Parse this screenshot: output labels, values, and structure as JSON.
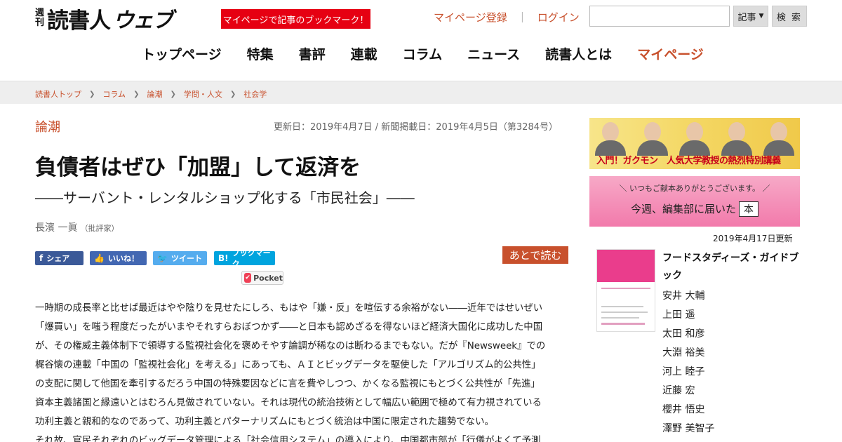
{
  "header": {
    "logo_sub": [
      "週",
      "刊"
    ],
    "logo_main": "読書人",
    "logo_web": "ウェブ",
    "bookmark_banner": "マイページで記事のブックマーク！",
    "register_link": "マイページ登録",
    "separator": "｜",
    "login_link": "ログイン",
    "search_placeholder": "",
    "search_scope": "記事",
    "search_button": "検 索"
  },
  "nav": {
    "items": [
      "トップページ",
      "特集",
      "書評",
      "連載",
      "コラム",
      "ニュース",
      "読書人とは",
      "マイページ"
    ]
  },
  "breadcrumb": [
    "読書人トップ",
    "コラム",
    "論潮",
    "学問・人文",
    "社会学"
  ],
  "article": {
    "category": "論潮",
    "dates": "更新日：2019年4月7日 / 新聞掲載日：2019年4月5日（第3284号）",
    "title": "負債者はぜひ「加盟」して返済を",
    "subtitle": "――サーバント・レンタルショップ化する「市民社会」――",
    "author": "長濱 一眞",
    "author_role": "（批評家）",
    "share": {
      "facebook": "シェア",
      "like": "いいね！",
      "twitter": "ツイート",
      "hatena": "ブックマーク",
      "hatena_icon": "B!",
      "pocket": "Pocket"
    },
    "read_later": "あとで読む",
    "paragraph_lines": [
      "一時期の成長率と比せば最近はやや陰りを見せたにしろ、もはや「嫌・反」を喧伝する余裕がない――近年ではせいぜい",
      "「爆買い」を嗤う程度だったがいまやそれすらおぼつかず――と日本も認めざるを得ないほど経済大国化に成功した中国",
      "が、その権威主義体制下で領導する監視社会化を褒めそやす論調が稀なのは断わるまでもない。だが『Newsweek』での",
      "梶谷懐の連載「中国の「監視社会化」を考える」にあっても、ＡＩとビッグデータを駆使した「アルゴリズム的公共性」",
      "の支配に関して他国を牽引するだろう中国の特殊要因などに言を費やしつつ、かくなる監視にもとづく公共性が「先進」",
      "資本主義諸国と縁遠いとはむろん見做されていない。それは現代の統治技術として幅広い範囲で極めて有力視されている",
      "功利主義と親和的なのであって、功利主義とパターナリズムにもとづく統治は中国に限定された趨勢でない。",
      "それ故、官民それぞれのビッグデータ管理による「社会信用システム」の導入により、中国都市部が「行儀がよくて予測"
    ]
  },
  "sidebar": {
    "banner1_caption": "入門！ガクモン　人気大学教授の熱烈特別講義",
    "banner2_top": "＼ いつもご献本ありがとうございます。 ／",
    "banner2_main": "今週、編集部に届いた",
    "banner2_box": "本",
    "updated": "2019年4月17日更新",
    "book": {
      "title": "フードスタディーズ・ガイドブック",
      "authors": [
        "安井 大輔",
        "上田 遥",
        "太田 和彦",
        "大淵 裕美",
        "河上 睦子",
        "近藤 宏",
        "櫻井 悟史",
        "澤野 美智子"
      ]
    }
  },
  "colors": {
    "accent": "#c8502c",
    "banner_red": "#e60012",
    "facebook": "#3b5998",
    "twitter": "#55acee",
    "hatena": "#00a4de"
  }
}
